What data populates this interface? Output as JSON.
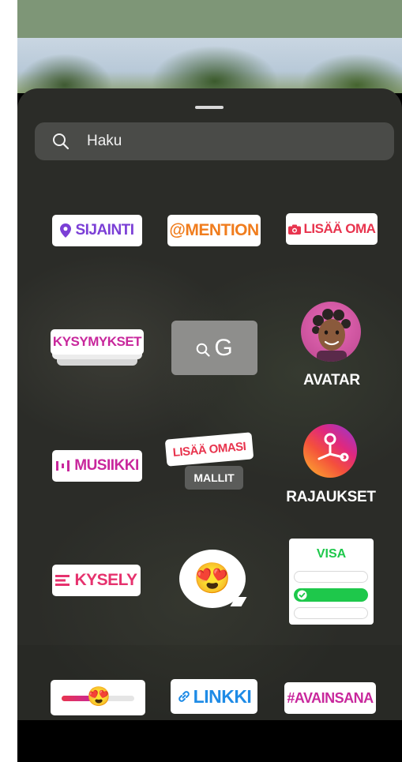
{
  "search": {
    "placeholder": "Haku"
  },
  "stickers": {
    "location": "SIJAINTI",
    "mention": "@MENTION",
    "add_yours": "LISÄÄ OMA",
    "questions": "KYSYMYKSET",
    "gif": "G",
    "avatar": "AVATAR",
    "music": "MUSIIKKI",
    "templates_top": "LISÄÄ OMASI",
    "templates_bottom": "MALLIT",
    "cutouts": "RAJAUKSET",
    "poll": "KYSELY",
    "emoji": "😍",
    "quiz": "VISA",
    "link": "LINKKI",
    "hashtag": "#AVAINSANA"
  },
  "colors": {
    "purple": "#7b3fd6",
    "orange": "#f07d1e",
    "red": "#e8344e",
    "magenta": "#c8279c",
    "blue": "#1e8be6",
    "green": "#1ec84b",
    "pink": "#e6326e"
  }
}
